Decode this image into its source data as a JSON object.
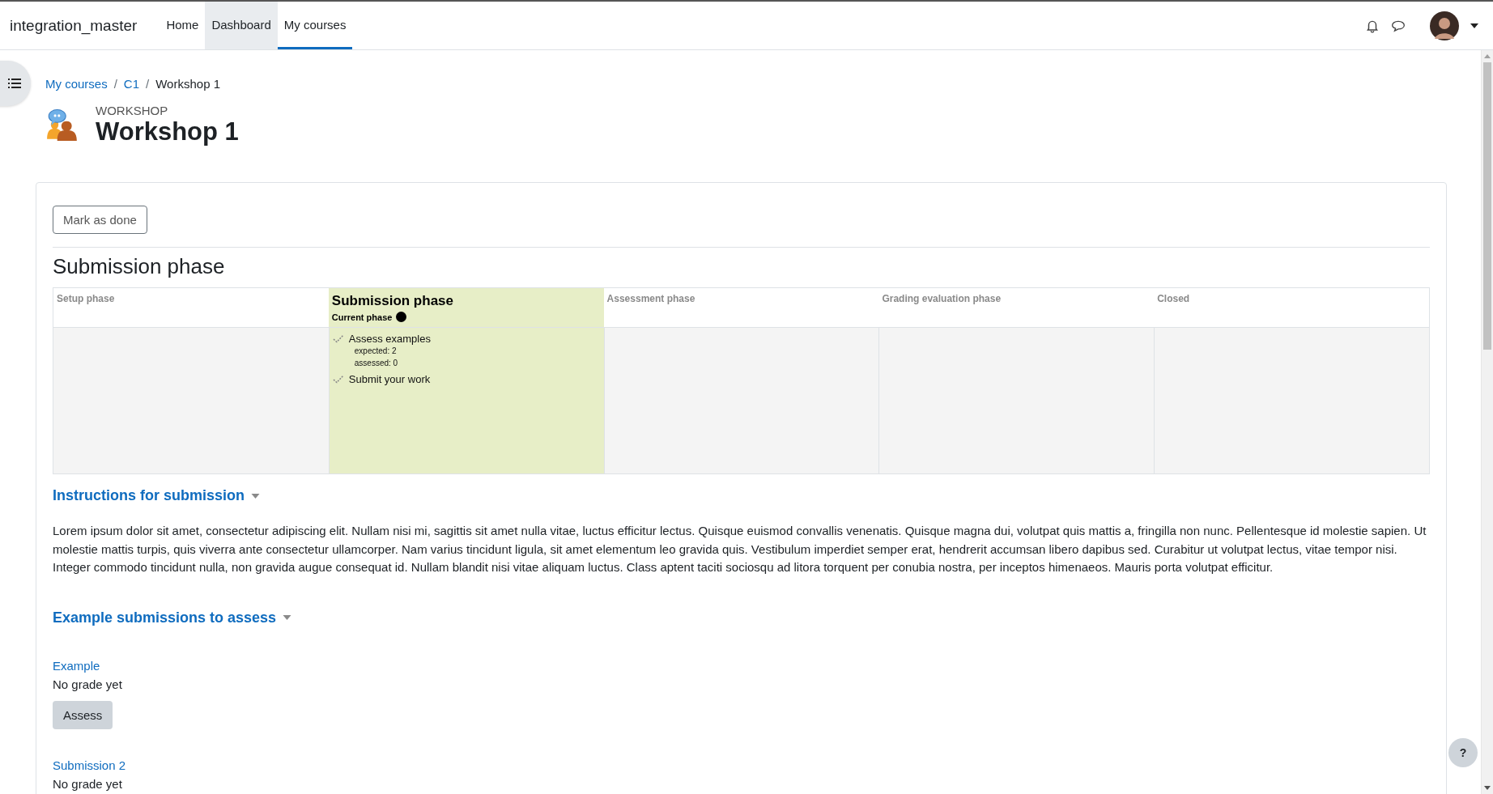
{
  "navbar": {
    "brand": "integration_master",
    "items": [
      {
        "label": "Home",
        "selected": false,
        "hovered": false
      },
      {
        "label": "Dashboard",
        "selected": false,
        "hovered": true
      },
      {
        "label": "My courses",
        "selected": true,
        "hovered": false
      }
    ]
  },
  "breadcrumb": [
    {
      "label": "My courses",
      "kind": "link"
    },
    {
      "label": "C1",
      "kind": "link"
    },
    {
      "label": "Workshop 1",
      "kind": "current"
    }
  ],
  "breadcrumb_separator": "/",
  "header": {
    "activity_type": "WORKSHOP",
    "title": "Workshop 1"
  },
  "mark_done_button": "Mark as done",
  "phase_heading": "Submission phase",
  "current_phase_label": "Current phase",
  "phases": [
    {
      "title": "Setup phase",
      "current": false
    },
    {
      "title": "Submission phase",
      "current": true,
      "tasks": [
        {
          "label": "Assess examples",
          "details": [
            "expected: 2",
            "assessed: 0"
          ]
        },
        {
          "label": "Submit your work"
        }
      ]
    },
    {
      "title": "Assessment phase",
      "current": false
    },
    {
      "title": "Grading evaluation phase",
      "current": false
    },
    {
      "title": "Closed",
      "current": false
    }
  ],
  "sections": [
    {
      "kind": "text",
      "heading": "Instructions for submission",
      "expanded": true,
      "text": "Lorem ipsum dolor sit amet, consectetur adipiscing elit. Nullam nisi mi, sagittis sit amet nulla vitae, luctus efficitur lectus. Quisque euismod convallis venenatis. Quisque magna dui, volutpat quis mattis a, fringilla non nunc. Pellentesque id molestie sapien. Ut molestie mattis turpis, quis viverra ante consectetur ullamcorper. Nam varius tincidunt ligula, sit amet elementum leo gravida quis. Vestibulum imperdiet semper erat, hendrerit accumsan libero dapibus sed. Curabitur ut volutpat lectus, vitae tempor nisi. Integer commodo tincidunt nulla, non gravida augue consequat id. Nullam blandit nisi vitae aliquam luctus. Class aptent taciti sociosqu ad litora torquent per conubia nostra, per inceptos himenaeos. Mauris porta volutpat efficitur."
    },
    {
      "kind": "examples",
      "heading": "Example submissions to assess",
      "expanded": true,
      "items": [
        {
          "title": "Example",
          "grade": "No grade yet",
          "button": "Assess"
        },
        {
          "title": "Submission 2",
          "grade": "No grade yet"
        }
      ]
    }
  ],
  "help_button": "?"
}
